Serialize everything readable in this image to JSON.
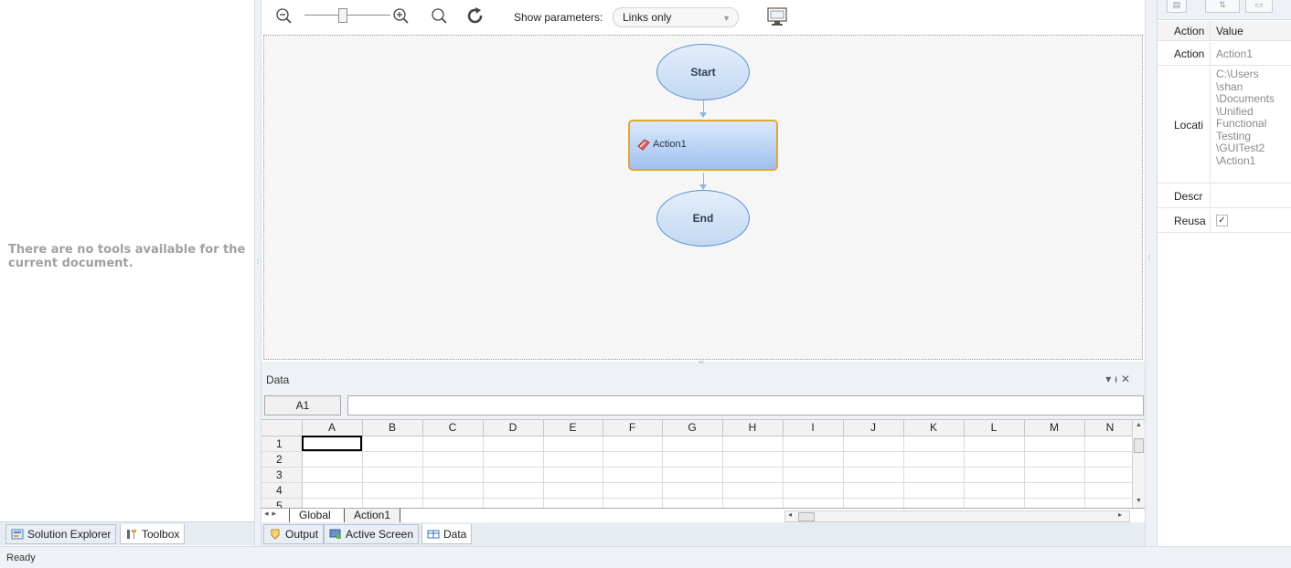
{
  "left_pane": {
    "message": "There are no tools available for the current document.",
    "tabs": [
      {
        "label": "Solution Explorer",
        "icon": "solution-explorer-icon"
      },
      {
        "label": "Toolbox",
        "icon": "toolbox-icon",
        "active": true
      }
    ]
  },
  "toolbar": {
    "zoom_out_icon": "zoom-out-icon",
    "zoom_in_icon": "zoom-in-icon",
    "zoom_fit_icon": "zoom-fit-icon",
    "refresh_icon": "refresh-icon",
    "show_parameters_label": "Show parameters:",
    "show_parameters_value": "Links only",
    "monitor_icon": "monitor-icon"
  },
  "flow": {
    "start_label": "Start",
    "action_label": "Action1",
    "end_label": "End"
  },
  "data_pane": {
    "title": "Data",
    "cell_ref": "A1",
    "formula": "",
    "columns": [
      "A",
      "B",
      "C",
      "D",
      "E",
      "F",
      "G",
      "H",
      "I",
      "J",
      "K",
      "L",
      "M",
      "N"
    ],
    "rows": [
      "1",
      "2",
      "3",
      "4",
      "5"
    ],
    "sheet_tabs": [
      "Global",
      "Action1"
    ],
    "bottom_tabs": [
      {
        "label": "Output",
        "icon": "output-icon"
      },
      {
        "label": "Active Screen",
        "icon": "active-screen-icon"
      },
      {
        "label": "Data",
        "icon": "data-icon",
        "active": true
      }
    ]
  },
  "properties": {
    "header": {
      "key": "Action",
      "value": "Value"
    },
    "rows": [
      {
        "key": "Action",
        "value": "Action1"
      },
      {
        "key": "Locati",
        "value": "C:\\Users \\shan \\Documents \\Unified Functional Testing \\GUITest2 \\Action1"
      },
      {
        "key": "Descr",
        "value": ""
      },
      {
        "key": "Reusa",
        "value": "✓"
      }
    ],
    "location_lines": [
      "C:\\Users",
      "\\shan",
      "\\Documents",
      "\\Unified",
      "Functional",
      "Testing",
      "\\GUITest2",
      "\\Action1"
    ]
  },
  "status": {
    "text": "Ready"
  },
  "colors": {
    "accent": "#e0a832",
    "node_border": "#5b8fd0",
    "pane_bg": "#eef2f7"
  }
}
